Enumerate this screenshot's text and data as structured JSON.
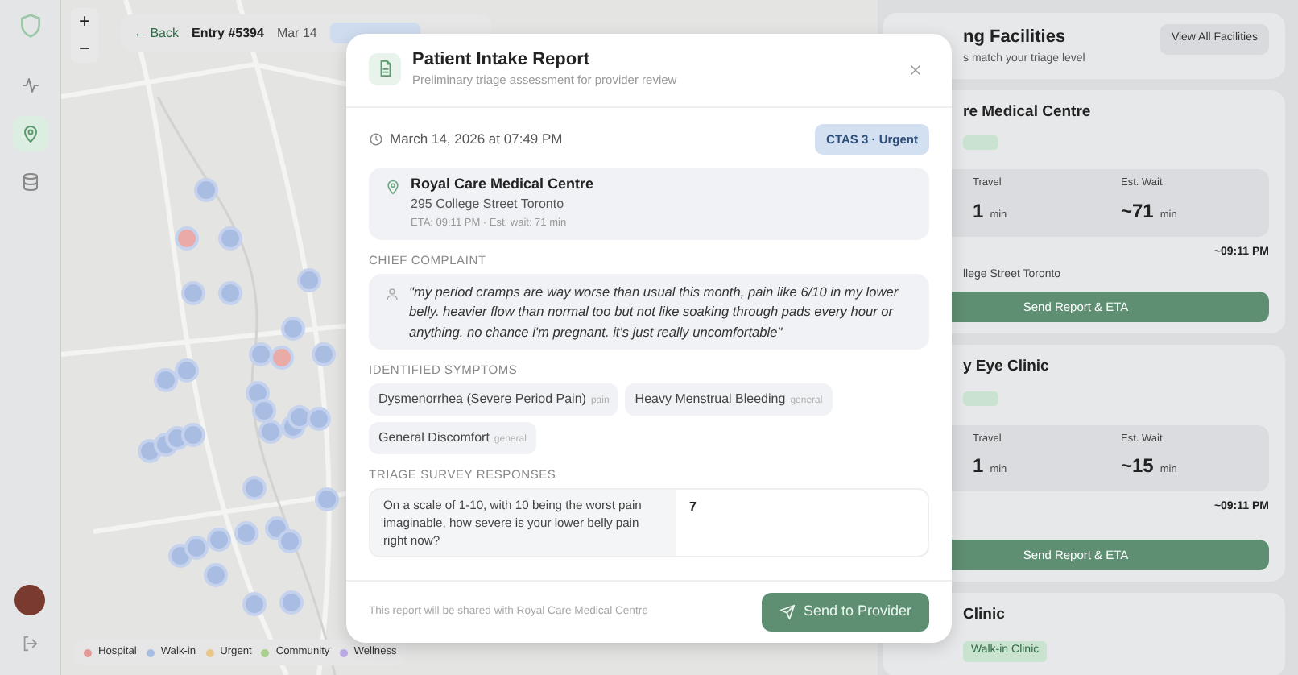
{
  "sidebar": {
    "items": [
      {
        "kind": "activity",
        "selected": false
      },
      {
        "kind": "map-pin",
        "selected": true
      },
      {
        "kind": "database",
        "selected": false
      }
    ]
  },
  "map_toolbar": {
    "zoom_in": "+",
    "zoom_out": "−",
    "back": "← Back",
    "entry": "Entry #5394",
    "date": "Mar 14"
  },
  "map_legend": [
    {
      "label": "Hospital",
      "color": "#e39a98"
    },
    {
      "label": "Walk-in",
      "color": "#a9bde3"
    },
    {
      "label": "Urgent",
      "color": "#e8c68e"
    },
    {
      "label": "Community",
      "color": "#a9d08e"
    },
    {
      "label": "Wellness",
      "color": "#bba9e3"
    }
  ],
  "facilities_panel": {
    "title": "ng Facilities",
    "subtitle": "s match your triage level",
    "view_all": "View All Facilities",
    "cards": [
      {
        "name": "re Medical Centre",
        "tag": true,
        "travel_label": "Travel",
        "travel": "1",
        "travel_unit": "min",
        "wait_label": "Est. Wait",
        "wait": "~71",
        "wait_unit": "min",
        "arrival": "~09:11 PM",
        "address": "llege Street Toronto",
        "button": "Send Report & ETA"
      },
      {
        "name": "y Eye Clinic",
        "tag": true,
        "travel_label": "Travel",
        "travel": "1",
        "travel_unit": "min",
        "wait_label": "Est. Wait",
        "wait": "~15",
        "wait_unit": "min",
        "arrival": "~09:11 PM",
        "button": "Send Report & ETA"
      },
      {
        "name": "Clinic",
        "tag_text": "Walk-in Clinic"
      }
    ]
  },
  "modal": {
    "title": "Patient Intake Report",
    "subtitle": "Preliminary triage assessment for provider review",
    "timestamp": "March 14, 2026 at 07:49 PM",
    "priority": "CTAS 3 · Urgent",
    "facility": {
      "name": "Royal Care Medical Centre",
      "address": "295 College Street Toronto",
      "eta": "ETA: 09:11 PM · Est. wait: 71 min"
    },
    "complaint_label": "CHIEF COMPLAINT",
    "complaint": "\"my period cramps are way worse than usual this month, pain like 6/10 in my lower belly. heavier flow than normal too but not like soaking through pads every hour or anything. no chance i'm pregnant. it's just really uncomfortable\"",
    "symptoms_label": "IDENTIFIED SYMPTOMS",
    "symptoms": [
      {
        "name": "Dysmenorrhea (Severe Period Pain)",
        "category": "pain"
      },
      {
        "name": "Heavy Menstrual Bleeding",
        "category": "general"
      },
      {
        "name": "General Discomfort",
        "category": "general"
      }
    ],
    "survey_label": "TRIAGE SURVEY RESPONSES",
    "survey": [
      {
        "question": "On a scale of 1-10, with 10 being the worst pain imaginable, how severe is your lower belly pain right now?",
        "answer": "7"
      }
    ],
    "footer_note": "This report will be shared with Royal Care Medical Centre",
    "send_button": "Send to Provider"
  }
}
